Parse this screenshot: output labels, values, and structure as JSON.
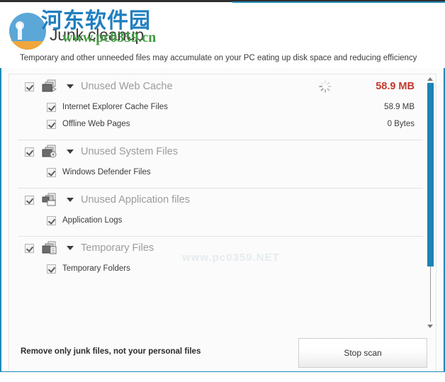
{
  "window": {
    "accent_color": "#2089b7",
    "app_title": "Junk cleanup",
    "subtitle": "Temporary and other unneeded files may accumulate on your PC eating up disk space and reducing efficiency"
  },
  "watermark": {
    "chinese": "河东软件园",
    "url": "www.pc0359.cn",
    "faint": "www.pc0359.NET"
  },
  "groups": [
    {
      "title": "Unused Web Cache",
      "icon": "web-cache-icon",
      "size": "58.9 MB",
      "checked": true,
      "scanning": true,
      "children": [
        {
          "label": "Internet Explorer Cache Files",
          "size": "58.9 MB",
          "checked": true
        },
        {
          "label": "Offline Web Pages",
          "size": "0 Bytes",
          "checked": true
        }
      ]
    },
    {
      "title": "Unused System Files",
      "icon": "system-files-icon",
      "size": "",
      "checked": true,
      "scanning": false,
      "children": [
        {
          "label": "Windows Defender Files",
          "size": "",
          "checked": true
        }
      ]
    },
    {
      "title": "Unused Application files",
      "icon": "application-files-icon",
      "size": "",
      "checked": true,
      "scanning": false,
      "children": [
        {
          "label": "Application Logs",
          "size": "",
          "checked": true
        }
      ]
    },
    {
      "title": "Temporary Files",
      "icon": "temporary-files-icon",
      "size": "",
      "checked": true,
      "scanning": false,
      "children": [
        {
          "label": "Temporary Folders",
          "size": "",
          "checked": true
        }
      ]
    }
  ],
  "footer": {
    "note": "Remove only junk files, not your personal files",
    "stop_button": "Stop scan"
  },
  "scrollbar": {
    "up_arrow": "scroll-up-arrow",
    "down_arrow": "scroll-down-arrow",
    "thumb_color": "#1b83b4"
  }
}
